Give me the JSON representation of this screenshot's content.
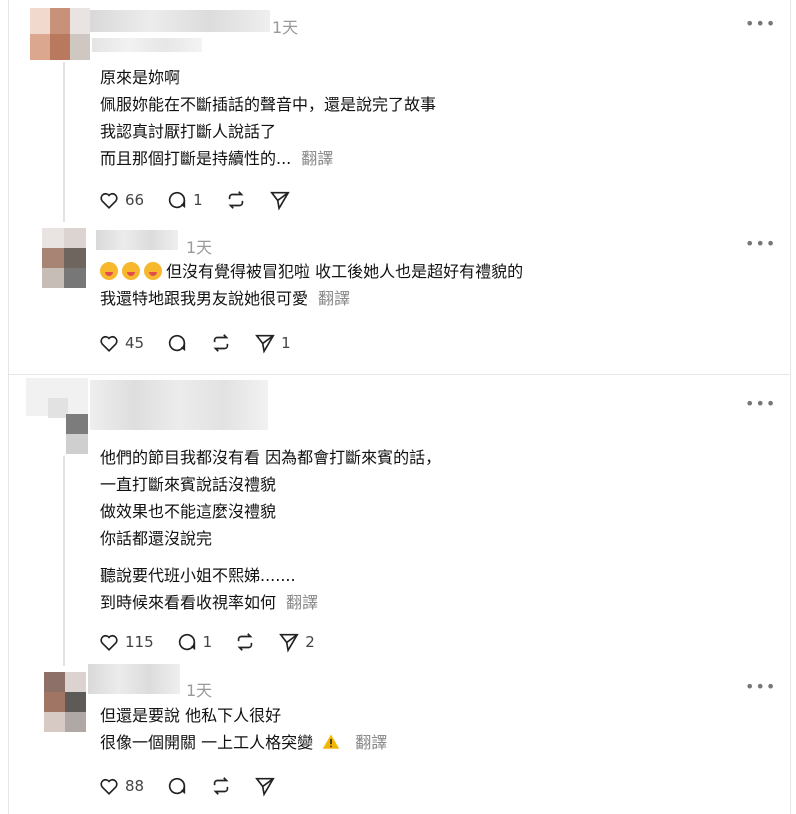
{
  "comments": [
    {
      "time": "1天",
      "lines": [
        "原來是妳啊",
        "佩服妳能在不斷插話的聲音中，還是說完了故事",
        "我認真討厭打斷人說話了",
        "而且那個打斷是持續性的..."
      ],
      "translate": "翻譯",
      "likes": "66",
      "replies": "1",
      "reposts": "",
      "shares": ""
    },
    {
      "time": "1天",
      "lines": [
        "但沒有覺得被冒犯啦 收工後她人也是超好有禮貌的",
        "我還特地跟我男友說她很可愛"
      ],
      "translate": "翻譯",
      "likes": "45",
      "replies": "",
      "reposts": "",
      "shares": "1"
    },
    {
      "time": "",
      "lines": [
        "他們的節目我都沒有看 因為都會打斷來賓的話，",
        "一直打斷來賓說話沒禮貌",
        "做效果也不能這麼沒禮貌",
        "你話都還沒說完",
        "",
        "聽說要代班小姐不熙娣.......",
        "到時候來看看收視率如何"
      ],
      "translate": "翻譯",
      "likes": "115",
      "replies": "1",
      "reposts": "",
      "shares": "2"
    },
    {
      "time": "1天",
      "lines": [
        "但還是要說 他私下人很好",
        "很像一個開關 一上工人格突變"
      ],
      "translate": "翻譯",
      "likes": "88",
      "replies": "",
      "reposts": "",
      "shares": ""
    }
  ],
  "more_label": "•••",
  "colors": {
    "text": "#111111",
    "muted": "#9a9a9a",
    "warning": "#f2b705"
  },
  "icons": [
    "heart-icon",
    "comment-icon",
    "repost-icon",
    "share-icon",
    "more-icon",
    "warning-icon"
  ]
}
